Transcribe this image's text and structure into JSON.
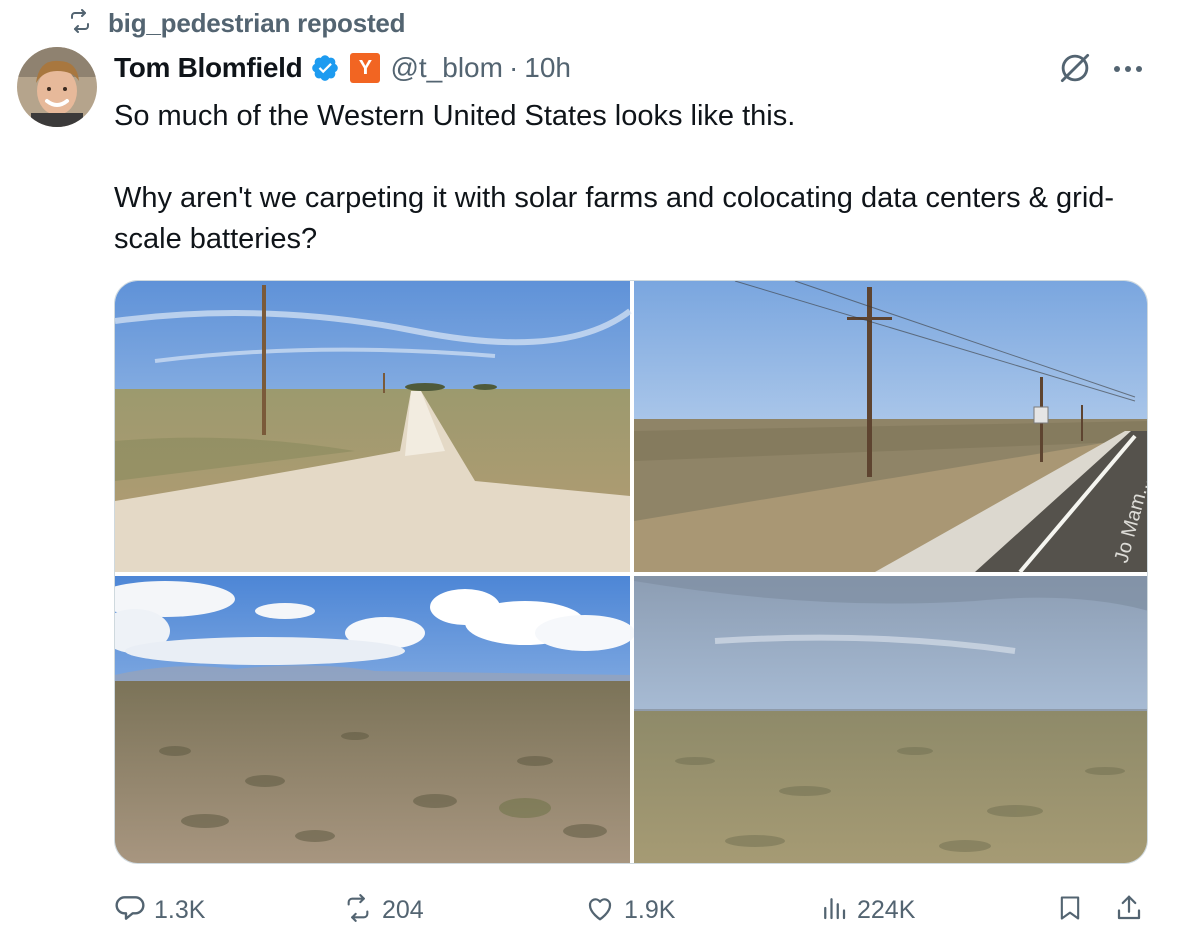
{
  "repost": {
    "label": "big_pedestrian reposted",
    "icon": "repost-icon"
  },
  "author": {
    "name": "Tom Blomfield",
    "affiliate_badge": "Y",
    "handle": "@t_blom",
    "separator": "·",
    "time": "10h"
  },
  "tweet": {
    "line1": "So much of the Western United States looks like this.",
    "line2": "Why aren't we carpeting it with solar farms and colocating data centers & grid-scale batteries?"
  },
  "media": {
    "road_sign_text": "Jo Mam..."
  },
  "actions": {
    "replies": "1.3K",
    "reposts": "204",
    "likes": "1.9K",
    "views": "224K"
  },
  "colors": {
    "verified": "#1d9bf0",
    "affiliate": "#f26522",
    "muted_text": "#536471",
    "text": "#0f1419"
  }
}
